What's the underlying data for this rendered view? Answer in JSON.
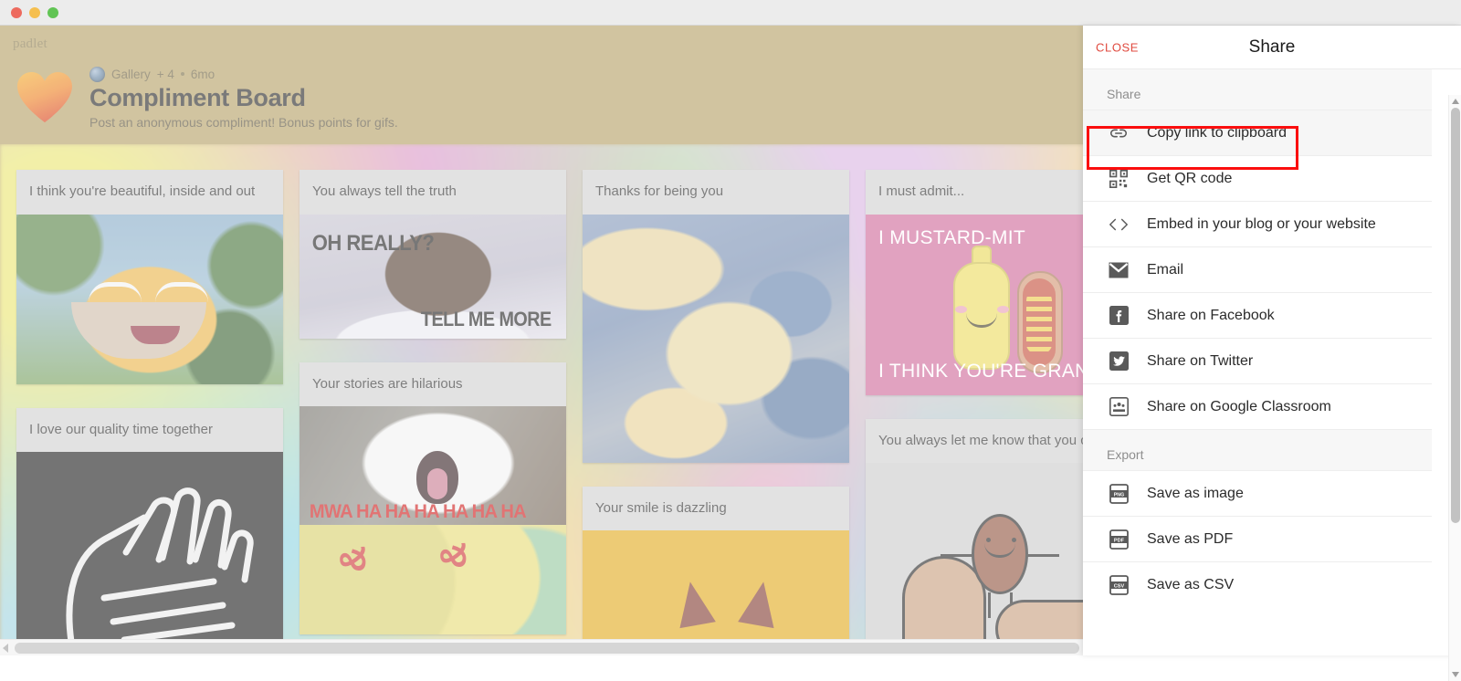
{
  "window": {
    "traffic_lights": [
      "close",
      "minimize",
      "maximize"
    ]
  },
  "board": {
    "brand": "padlet",
    "icon": "heart-icon",
    "format": "Gallery",
    "contributors": "+ 4",
    "age": "6mo",
    "title": "Compliment Board",
    "description": "Post an anonymous compliment! Bonus points for gifs.",
    "columns": [
      {
        "posts": [
          {
            "title": "I think you're beautiful, inside and out",
            "media": "psyduck-gif",
            "media_text": []
          },
          {
            "title": "I love our quality time together",
            "media": "hands-drawing-gif",
            "media_text": []
          }
        ]
      },
      {
        "posts": [
          {
            "title": "You always tell the truth",
            "media": "sloth-meme-gif",
            "media_text": [
              "OH REALLY?",
              "TELL ME MORE"
            ]
          },
          {
            "title": "Your stories are hilarious",
            "media": "laughing-fox-gif",
            "media_text": [
              "MWA HA HA HA HA HA HA",
              "&",
              "&"
            ]
          }
        ]
      },
      {
        "posts": [
          {
            "title": "Thanks for being you",
            "media": "clouds-gif",
            "media_text": []
          },
          {
            "title": "Your smile is dazzling",
            "media": "orange-cat-gif",
            "media_text": []
          }
        ]
      },
      {
        "posts": [
          {
            "title": "I must admit...",
            "media": "mustard-hotdog-gif",
            "media_text": [
              "I MUSTARD-MIT",
              "I THINK YOU'RE GRAND"
            ]
          },
          {
            "title": "You always let me know that you care",
            "media": "bean-high-five-gif",
            "media_text": []
          }
        ]
      }
    ]
  },
  "share_panel": {
    "close_label": "CLOSE",
    "title": "Share",
    "sections": [
      {
        "heading": "Share",
        "items": [
          {
            "label": "Copy link to clipboard",
            "icon": "link-icon",
            "highlighted": true
          },
          {
            "label": "Get QR code",
            "icon": "qr-code-icon",
            "highlighted": false
          },
          {
            "label": "Embed in your blog or your website",
            "icon": "code-brackets-icon",
            "highlighted": false
          },
          {
            "label": "Email",
            "icon": "envelope-icon",
            "highlighted": false
          },
          {
            "label": "Share on Facebook",
            "icon": "facebook-icon",
            "highlighted": false
          },
          {
            "label": "Share on Twitter",
            "icon": "twitter-icon",
            "highlighted": false
          },
          {
            "label": "Share on Google Classroom",
            "icon": "google-classroom-icon",
            "highlighted": false
          }
        ]
      },
      {
        "heading": "Export",
        "items": [
          {
            "label": "Save as image",
            "icon": "png-file-icon",
            "highlighted": false
          },
          {
            "label": "Save as PDF",
            "icon": "pdf-file-icon",
            "highlighted": false
          },
          {
            "label": "Save as CSV",
            "icon": "csv-file-icon",
            "highlighted": false
          }
        ]
      }
    ]
  },
  "colors": {
    "accent_red": "#e04a3f",
    "highlight_red": "#fb0e0e",
    "board_header_bg": "#b09a5c",
    "post_bg": "#cdcdcd",
    "panel_bg": "#ffffff"
  }
}
